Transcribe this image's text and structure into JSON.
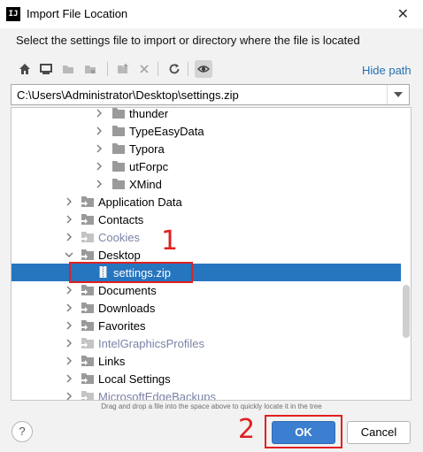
{
  "window": {
    "title": "Import File Location",
    "app_icon_text": "IJ",
    "close_symbol": "✕"
  },
  "instruction": "Select the settings file to import or directory where the file is located",
  "toolbar": {
    "buttons": [
      "home-icon",
      "desktop-icon",
      "project-folder-icon",
      "module-folder-icon",
      "new-folder-icon",
      "delete-icon",
      "refresh-icon",
      "show-hidden-icon"
    ],
    "hide_path_label": "Hide path"
  },
  "path": {
    "value": "C:\\Users\\Administrator\\Desktop\\settings.zip"
  },
  "tree": {
    "rows": [
      {
        "label": "thunder",
        "expandable": true,
        "dim": false,
        "icon": "folder"
      },
      {
        "label": "TypeEasyData",
        "expandable": true,
        "dim": false,
        "icon": "folder"
      },
      {
        "label": "Typora",
        "expandable": true,
        "dim": false,
        "icon": "folder"
      },
      {
        "label": "utForpc",
        "expandable": true,
        "dim": false,
        "icon": "folder"
      },
      {
        "label": "XMind",
        "expandable": true,
        "dim": false,
        "icon": "folder"
      },
      {
        "label": "Application Data",
        "expandable": true,
        "dim": false,
        "icon": "folder-link"
      },
      {
        "label": "Contacts",
        "expandable": true,
        "dim": false,
        "icon": "folder-link"
      },
      {
        "label": "Cookies",
        "expandable": true,
        "dim": true,
        "icon": "folder-link"
      },
      {
        "label": "Desktop",
        "expandable": true,
        "expanded": true,
        "dim": false,
        "icon": "folder-link"
      },
      {
        "label": "settings.zip",
        "expandable": false,
        "dim": false,
        "icon": "zip",
        "selected": true
      },
      {
        "label": "Documents",
        "expandable": true,
        "dim": false,
        "icon": "folder-link"
      },
      {
        "label": "Downloads",
        "expandable": true,
        "dim": false,
        "icon": "folder-link"
      },
      {
        "label": "Favorites",
        "expandable": true,
        "dim": false,
        "icon": "folder-link"
      },
      {
        "label": "IntelGraphicsProfiles",
        "expandable": true,
        "dim": true,
        "icon": "folder-link"
      },
      {
        "label": "Links",
        "expandable": true,
        "dim": false,
        "icon": "folder-link"
      },
      {
        "label": "Local Settings",
        "expandable": true,
        "dim": false,
        "icon": "folder-link"
      },
      {
        "label": "MicrosoftEdgeBackups",
        "expandable": true,
        "dim": true,
        "icon": "folder-link"
      }
    ]
  },
  "hint": "Drag and drop a file into the space above to quickly locate it in the tree",
  "annotations": {
    "one": "1",
    "two": "2"
  },
  "buttons": {
    "help": "?",
    "ok": "OK",
    "cancel": "Cancel"
  },
  "colors": {
    "selection": "#2675bf",
    "ok_button": "#3c7ed0",
    "link": "#2470b3",
    "annotation": "#e02020"
  }
}
